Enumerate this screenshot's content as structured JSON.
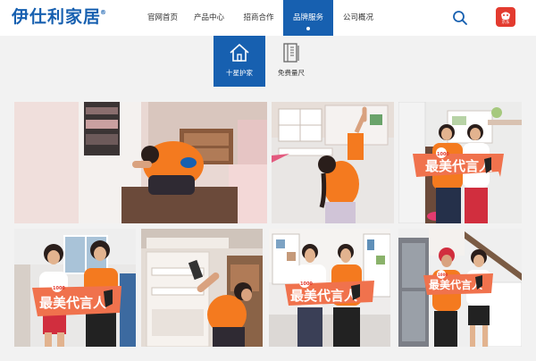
{
  "brand": {
    "logo_text": "伊仕利家居",
    "logo_mark": "®"
  },
  "nav": {
    "items": [
      {
        "label": "官网首页",
        "active": false
      },
      {
        "label": "产品中心",
        "active": false
      },
      {
        "label": "招商合作",
        "active": false
      },
      {
        "label": "品牌服务",
        "active": true
      },
      {
        "label": "公司概况",
        "active": false
      }
    ]
  },
  "header_icons": {
    "search": "search-icon",
    "app": "jd-app-icon",
    "app_label": "京东"
  },
  "subnav": {
    "tabs": [
      {
        "label": "十星护家",
        "icon": "house-icon",
        "active": true
      },
      {
        "label": "免费量尺",
        "icon": "ruler-book-icon",
        "active": false
      }
    ]
  },
  "gallery": {
    "sign_text": "最美代言人",
    "sign_badge": "1000",
    "photos": [
      {
        "kind": "worker-closet"
      },
      {
        "kind": "worker-shelf"
      },
      {
        "kind": "ambassadors-sign"
      },
      {
        "kind": "ambassadors-sign"
      },
      {
        "kind": "worker-cabinet"
      },
      {
        "kind": "ambassadors-sign"
      },
      {
        "kind": "ambassadors-sign"
      }
    ]
  },
  "colors": {
    "brand_blue": "#1760b0",
    "uniform_orange": "#f47a1f",
    "sign_orange": "#f0724d",
    "band_gray": "#f2f2f2"
  }
}
